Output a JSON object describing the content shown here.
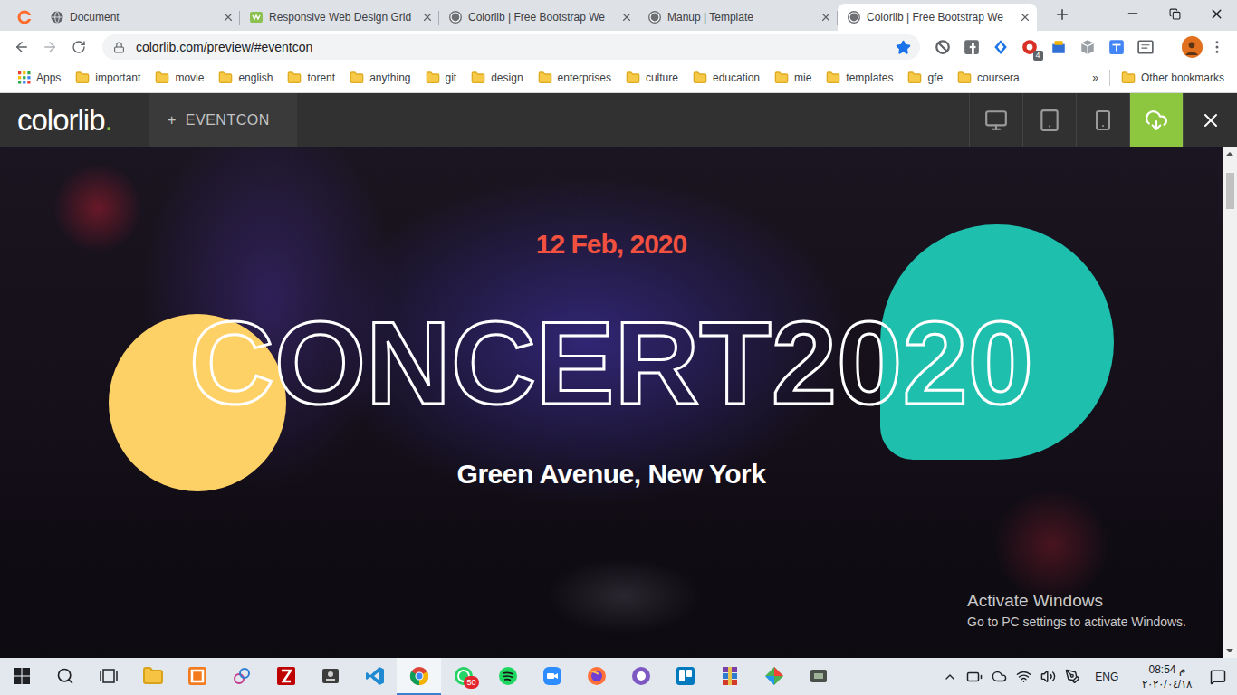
{
  "browser": {
    "tabs": [
      {
        "label": "Document",
        "selected": false
      },
      {
        "label": "Responsive Web Design Grid",
        "selected": false
      },
      {
        "label": "Colorlib | Free Bootstrap We",
        "selected": false
      },
      {
        "label": "Manup | Template",
        "selected": false
      },
      {
        "label": "Colorlib | Free Bootstrap We",
        "selected": true
      }
    ],
    "url": "colorlib.com/preview/#eventcon",
    "bookmarked": true,
    "extension_badge": "4"
  },
  "bookmarks": {
    "apps": "Apps",
    "folders": [
      "important",
      "movie",
      "english",
      "torent",
      "anything",
      "git",
      "design",
      "enterprises",
      "culture",
      "education",
      "mie",
      "templates",
      "gfe",
      "coursera"
    ],
    "more": "»",
    "other": "Other bookmarks"
  },
  "preview_bar": {
    "logo": "colorlib",
    "logo_dot": ".",
    "project_icon": "+",
    "project": "EVENTCON"
  },
  "hero": {
    "date": "12 Feb, 2020",
    "title": "CONCERT2020",
    "venue": "Green Avenue, New York"
  },
  "watermark": {
    "title": "Activate Windows",
    "subtitle": "Go to PC settings to activate Windows."
  },
  "taskbar": {
    "apps": [
      {
        "active": false
      },
      {
        "active": false
      },
      {
        "active": false
      },
      {
        "active": false
      },
      {
        "active": false
      },
      {
        "active": false
      },
      {
        "active": true
      },
      {
        "active": false,
        "badge": "50"
      },
      {
        "active": false
      },
      {
        "active": false
      },
      {
        "active": false
      },
      {
        "active": false
      },
      {
        "active": false
      },
      {
        "active": false
      },
      {
        "active": false
      },
      {
        "active": false
      }
    ],
    "language": "ENG",
    "time": "08:54 م",
    "date": "٢٠٢٠/٠٤/١٨"
  }
}
